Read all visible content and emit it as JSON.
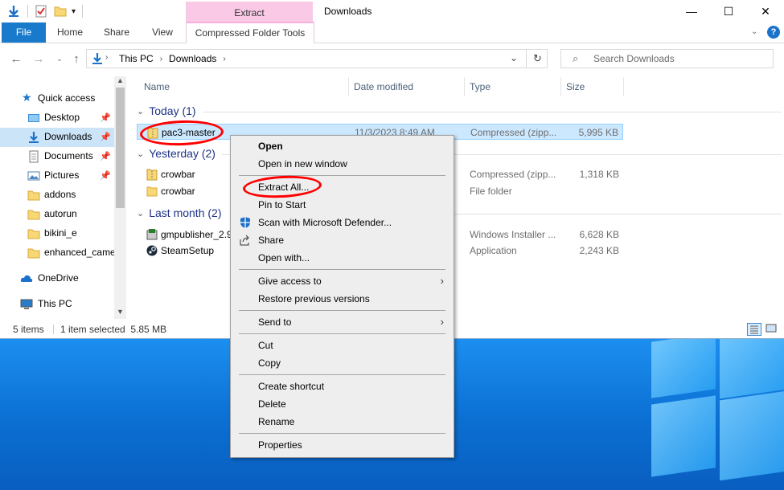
{
  "window": {
    "title": "Downloads",
    "contextual_tab_header": "Extract",
    "controls": {
      "minimize": "—",
      "maximize": "☐",
      "close": "✕"
    }
  },
  "ribbon": {
    "tabs": [
      "File",
      "Home",
      "Share",
      "View"
    ],
    "contextual_tab": "Compressed Folder Tools"
  },
  "address": {
    "crumbs": [
      "This PC",
      "Downloads"
    ],
    "search_placeholder": "Search Downloads"
  },
  "nav": {
    "items": [
      {
        "label": "Quick access",
        "icon": "star-icon"
      },
      {
        "label": "Desktop",
        "icon": "desktop-folder-icon",
        "pinned": true
      },
      {
        "label": "Downloads",
        "icon": "downloads-icon",
        "pinned": true,
        "selected": true
      },
      {
        "label": "Documents",
        "icon": "documents-icon",
        "pinned": true
      },
      {
        "label": "Pictures",
        "icon": "pictures-icon",
        "pinned": true
      },
      {
        "label": "addons",
        "icon": "folder-icon"
      },
      {
        "label": "autorun",
        "icon": "folder-icon"
      },
      {
        "label": "bikini_e",
        "icon": "folder-icon"
      },
      {
        "label": "enhanced_came",
        "icon": "folder-icon"
      },
      {
        "label": "OneDrive",
        "icon": "cloud-icon"
      },
      {
        "label": "This PC",
        "icon": "computer-icon"
      }
    ]
  },
  "columns": [
    "Name",
    "Date modified",
    "Type",
    "Size"
  ],
  "groups": [
    {
      "label": "Today (1)",
      "files": [
        {
          "name": "pac3-master",
          "date": "11/3/2023 8:49 AM",
          "type": "Compressed (zipp...",
          "size": "5,995 KB",
          "icon": "zip-folder-icon",
          "selected": true
        }
      ]
    },
    {
      "label": "Yesterday (2)",
      "files": [
        {
          "name": "crowbar",
          "date": "",
          "type": "Compressed (zipp...",
          "size": "1,318 KB",
          "icon": "zip-folder-icon"
        },
        {
          "name": "crowbar",
          "date": "",
          "type": "File folder",
          "size": "",
          "icon": "folder-icon"
        }
      ]
    },
    {
      "label": "Last month (2)",
      "files": [
        {
          "name": "gmpublisher_2.9",
          "date": "",
          "type": "Windows Installer ...",
          "size": "6,628 KB",
          "icon": "installer-icon"
        },
        {
          "name": "SteamSetup",
          "date": "",
          "type": "Application",
          "size": "2,243 KB",
          "icon": "steam-icon"
        }
      ]
    }
  ],
  "status": {
    "count": "5 items",
    "selection": "1 item selected  5.85 MB"
  },
  "context_menu": [
    {
      "label": "Open",
      "bold": true
    },
    {
      "label": "Open in new window"
    },
    {
      "sep": true
    },
    {
      "label": "Extract All..."
    },
    {
      "label": "Pin to Start"
    },
    {
      "label": "Scan with Microsoft Defender...",
      "icon": "defender-icon"
    },
    {
      "label": "Share",
      "icon": "share-icon"
    },
    {
      "label": "Open with..."
    },
    {
      "sep": true
    },
    {
      "label": "Give access to",
      "submenu": true
    },
    {
      "label": "Restore previous versions"
    },
    {
      "sep": true
    },
    {
      "label": "Send to",
      "submenu": true
    },
    {
      "sep": true
    },
    {
      "label": "Cut"
    },
    {
      "label": "Copy"
    },
    {
      "sep": true
    },
    {
      "label": "Create shortcut"
    },
    {
      "label": "Delete"
    },
    {
      "label": "Rename"
    },
    {
      "sep": true
    },
    {
      "label": "Properties"
    }
  ],
  "colors": {
    "accent": "#1979ca",
    "selection": "#cce8ff",
    "annotation": "#ff0000"
  }
}
